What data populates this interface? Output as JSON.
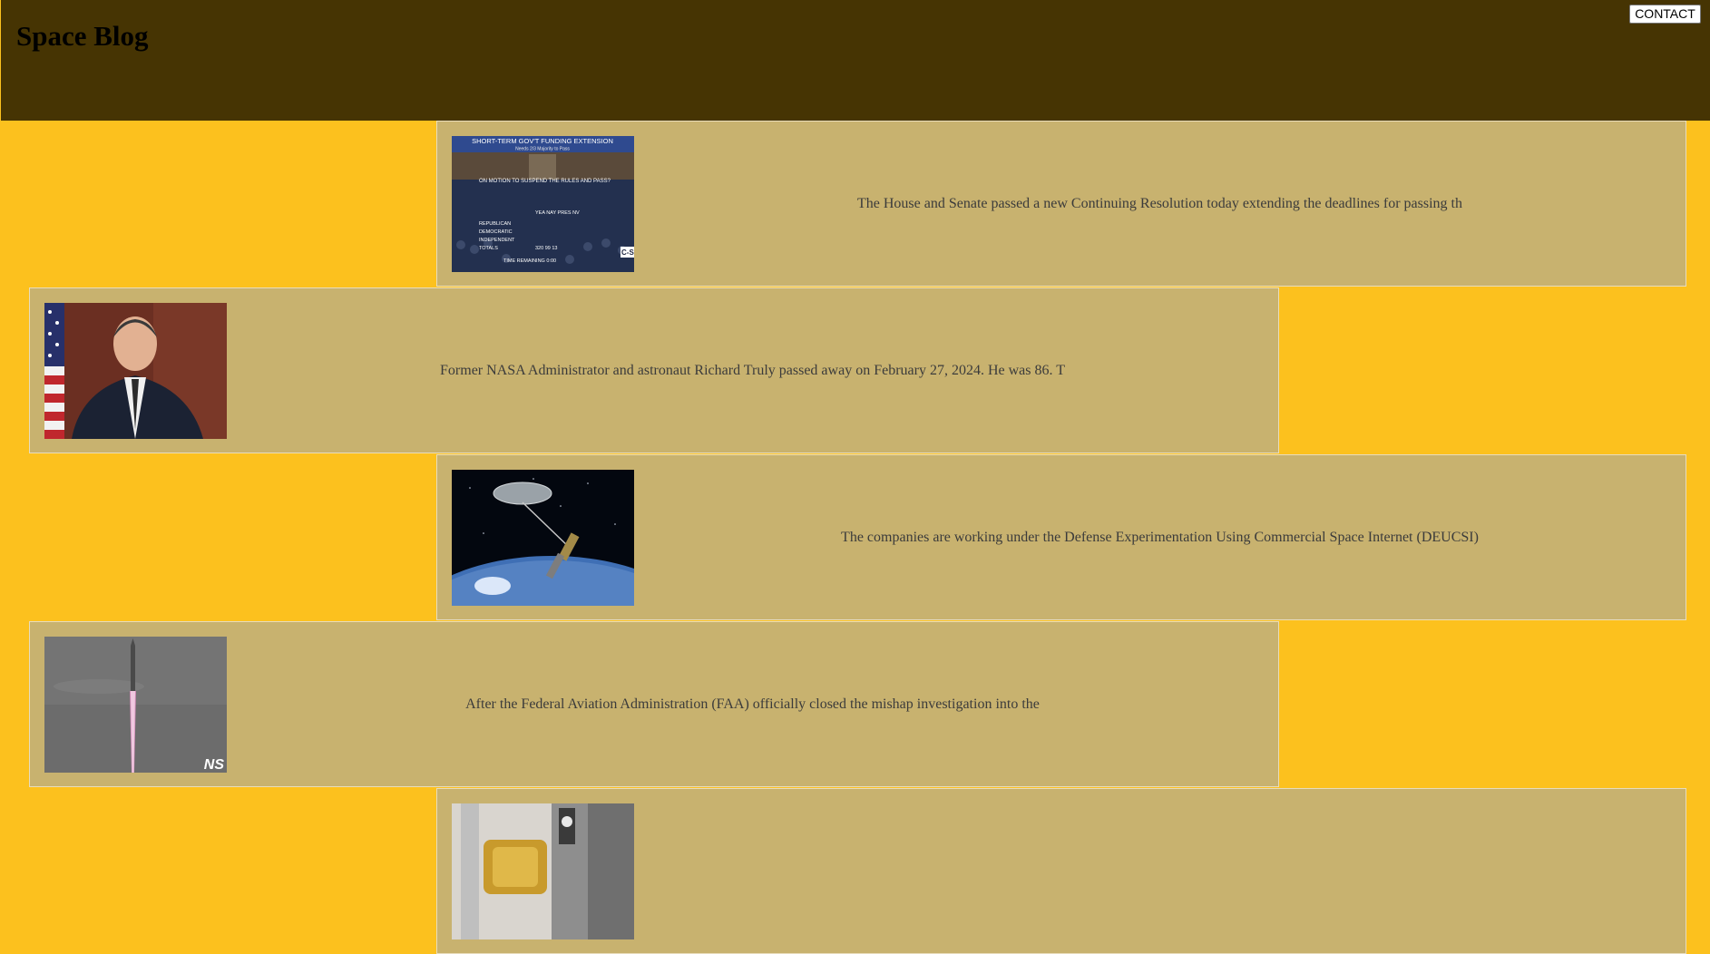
{
  "header": {
    "title": "Space Blog",
    "contact_label": "CONTACT"
  },
  "posts": [
    {
      "excerpt": "The House and Senate passed a new Continuing Resolution today extending the deadlines for passing th",
      "image_icon": "house-vote-tally-image",
      "image_text": {
        "banner": "SHORT-TERM GOV'T FUNDING EXTENSION",
        "subbanner": "Needs 2/3 Majority to Pass",
        "motion": "ON MOTION TO SUSPEND THE RULES AND PASS?",
        "columns": "YEA  NAY  PRES  NV",
        "rows": [
          "REPUBLICAN",
          "DEMOCRATIC",
          "INDEPENDENT",
          "TOTALS"
        ],
        "totals": "320  99  13",
        "time": "TIME REMAINING  0:00",
        "logo": "C-S"
      }
    },
    {
      "excerpt": "Former NASA Administrator and astronaut Richard Truly passed away on February 27, 2024. He was 86. T",
      "image_icon": "portrait-with-flag-image"
    },
    {
      "excerpt": "The companies are working under the Defense Experimentation Using Commercial Space Internet (DEUCSI)",
      "image_icon": "satellite-over-earth-image"
    },
    {
      "excerpt": "After the Federal Aviation Administration (FAA) officially closed the mishap investigation into the",
      "image_icon": "rocket-launch-image",
      "image_text": {
        "watermark": "NS"
      }
    },
    {
      "excerpt": "",
      "image_icon": "spacecraft-hardware-image"
    }
  ],
  "colors": {
    "page_background": "#fcc11e",
    "header_background": "#463403",
    "card_background": "#c8b26f",
    "excerpt_text": "#3b3b3b"
  }
}
